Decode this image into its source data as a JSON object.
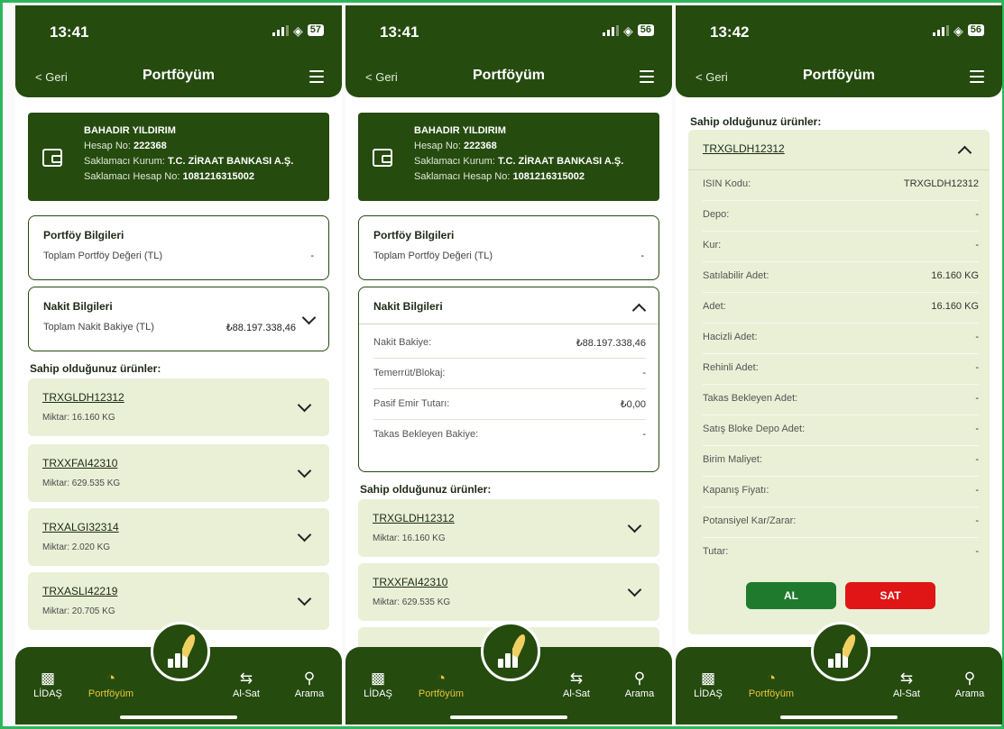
{
  "common": {
    "back_label": "< Geri",
    "page_title": "Portföyüm",
    "tabs": [
      "LİDAŞ",
      "Portföyüm",
      "Al-Sat",
      "Arama"
    ],
    "colors": {
      "primary": "#254b0f",
      "active_tab": "#e8c43a",
      "buy": "#1f7a2e",
      "sell": "#e01515",
      "product_bg": "#e9f0d6"
    }
  },
  "screens": [
    {
      "time": "13:41",
      "battery": "57"
    },
    {
      "time": "13:41",
      "battery": "56"
    },
    {
      "time": "13:42",
      "battery": "56"
    }
  ],
  "account": {
    "name": "BAHADIR YILDIRIM",
    "hesap_label": "Hesap No:",
    "hesap_value": "222368",
    "kurum_label": "Saklamacı Kurum:",
    "kurum_value": "T.C. ZİRAAT BANKASI A.Ş.",
    "saklamaci_label": "Saklamacı Hesap No:",
    "saklamaci_value": "1081216315002"
  },
  "portfoy": {
    "title": "Portföy Bilgileri",
    "label": "Toplam Portföy Değeri (TL)",
    "value": "-"
  },
  "nakit": {
    "title": "Nakit Bilgileri",
    "label": "Toplam Nakit Bakiye (TL)",
    "value": "₺88.197.338,46",
    "rows": [
      {
        "label": "Nakit Bakiye:",
        "value": "₺88.197.338,46"
      },
      {
        "label": "Temerrüt/Blokaj:",
        "value": "-"
      },
      {
        "label": "Pasif Emir Tutarı:",
        "value": "₺0,00"
      },
      {
        "label": "Takas Bekleyen Bakiye:",
        "value": "-"
      }
    ]
  },
  "products_title": "Sahip olduğunuz ürünler:",
  "products": [
    {
      "code": "TRXGLDH12312",
      "qty": "Miktar: 16.160 KG"
    },
    {
      "code": "TRXXFAI42310",
      "qty": "Miktar: 629.535 KG"
    },
    {
      "code": "TRXALGI32314",
      "qty": "Miktar: 2.020 KG"
    },
    {
      "code": "TRXASLI42219",
      "qty": "Miktar: 20.705 KG"
    }
  ],
  "detail": {
    "code": "TRXGLDH12312",
    "rows": [
      {
        "label": "ISIN Kodu:",
        "value": "TRXGLDH12312"
      },
      {
        "label": "Depo:",
        "value": "-"
      },
      {
        "label": "Kur:",
        "value": "-"
      },
      {
        "label": "Satılabilir Adet:",
        "value": "16.160 KG"
      },
      {
        "label": "Adet:",
        "value": "16.160 KG"
      },
      {
        "label": "Hacizli Adet:",
        "value": "-"
      },
      {
        "label": "Rehinli Adet:",
        "value": "-"
      },
      {
        "label": "Takas Bekleyen Adet:",
        "value": "-"
      },
      {
        "label": "Satış Bloke Depo Adet:",
        "value": "-"
      },
      {
        "label": "Birim Maliyet:",
        "value": "-"
      },
      {
        "label": "Kapanış Fiyatı:",
        "value": "-"
      },
      {
        "label": "Potansiyel Kar/Zarar:",
        "value": "-"
      },
      {
        "label": "Tutar:",
        "value": "-"
      }
    ],
    "buy_label": "AL",
    "sell_label": "SAT"
  }
}
